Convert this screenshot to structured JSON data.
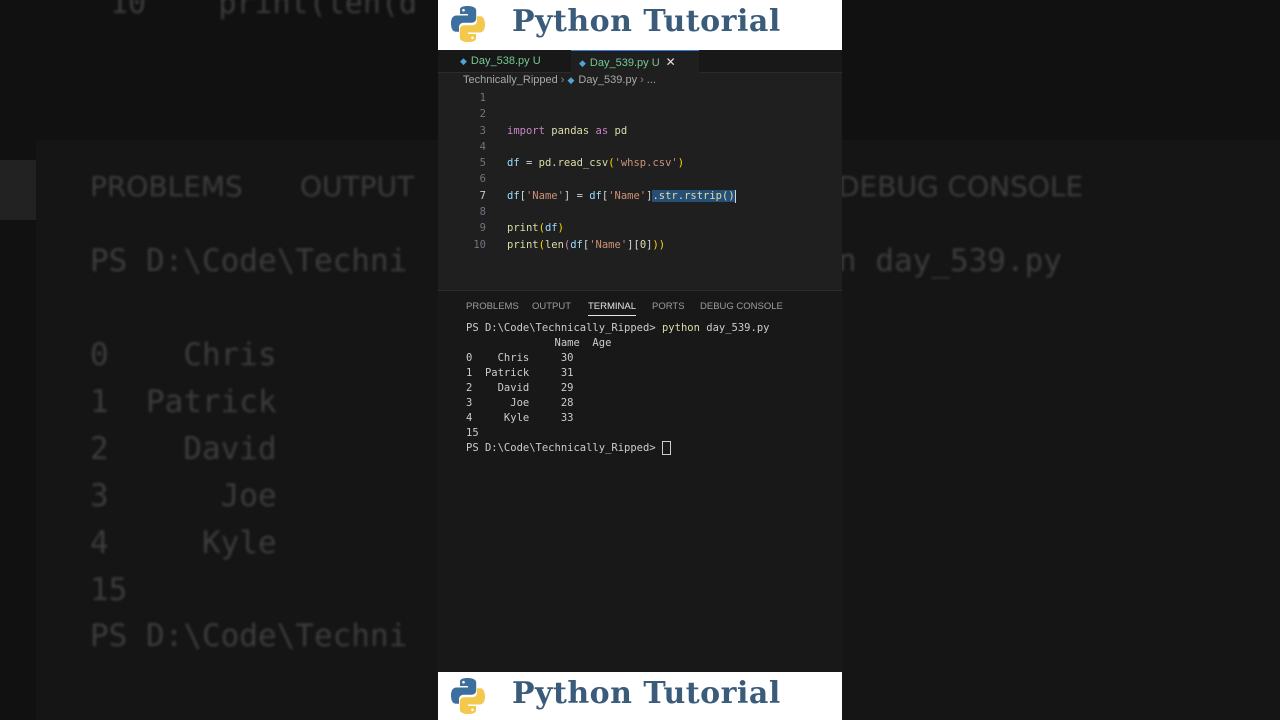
{
  "banner": {
    "title": "Python Tutorial",
    "logo_icon": "python-logo-icon"
  },
  "editor": {
    "tabs": [
      {
        "label": "Day_538.py",
        "status": "U"
      },
      {
        "label": "Day_539.py",
        "status": "U",
        "close": "✕"
      }
    ],
    "breadcrumb": {
      "folder": "Technically_Ripped",
      "file": "Day_539.py",
      "more": "..."
    },
    "current_line": 7,
    "lines": [
      {
        "n": "1"
      },
      {
        "n": "2"
      },
      {
        "n": "3"
      },
      {
        "n": "4"
      },
      {
        "n": "5"
      },
      {
        "n": "6"
      },
      {
        "n": "7"
      },
      {
        "n": "8"
      },
      {
        "n": "9"
      },
      {
        "n": "10"
      }
    ],
    "code": {
      "l3": {
        "kw1": "import",
        "mod": "pandas",
        "kw2": "as",
        "alias": "pd"
      },
      "l5": {
        "var": "df",
        "eq": " = ",
        "obj": "pd",
        "dot": ".",
        "fn": "read_csv",
        "open": "(",
        "str": "'whsp.csv'",
        "close": ")"
      },
      "l7": {
        "a": "df",
        "b": "[",
        "c": "'Name'",
        "d": "] = ",
        "e": "df",
        "f": "[",
        "g": "'Name'",
        "h": "]",
        "sel": ".str.rstrip()"
      },
      "l9": {
        "fn": "print",
        "open": "(",
        "arg": "df",
        "close": ")"
      },
      "l10": {
        "fn": "print",
        "o1": "(",
        "fn2": "len",
        "o2": "(",
        "v": "df",
        "b1": "[",
        "s": "'Name'",
        "b2": "][",
        "idx": "0",
        "b3": "]",
        "c": "))"
      }
    }
  },
  "panel": {
    "tabs": [
      "PROBLEMS",
      "OUTPUT",
      "TERMINAL",
      "PORTS",
      "DEBUG CONSOLE"
    ],
    "active_tab": "TERMINAL",
    "terminal": {
      "prompt": "PS D:\\Code\\Technically_Ripped>",
      "command": "python",
      "arg": " day_539.py",
      "lines": [
        "              Name  Age",
        "0    Chris     30",
        "1  Patrick     31",
        "2    David     29",
        "3      Joe     28",
        "4     Kyle     33",
        "15"
      ]
    }
  },
  "background": {
    "tabs": [
      "PROBLEMS",
      "OUTPUT",
      "DEBUG CONSOLE"
    ],
    "top_line": "10    print(len(d",
    "prompt": "PS D:\\Code\\Techni",
    "prompt2": "PS D:\\Code\\Techni",
    "cmd_tail": "n day_539.py",
    "rows": [
      "0    Chris",
      "1  Patrick",
      "2    David",
      "3      Joe",
      "4     Kyle",
      "15"
    ]
  }
}
